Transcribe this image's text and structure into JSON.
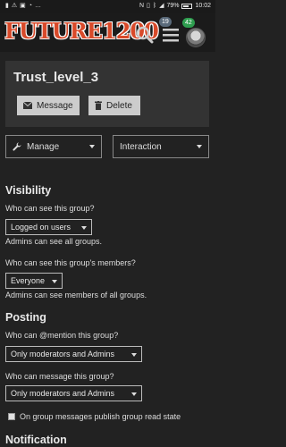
{
  "status_bar": {
    "icons_left": [
      "signal-icon",
      "warning-icon",
      "image-icon",
      "wifi-icon",
      "more-icon"
    ],
    "battery": "79%",
    "battery_level": 0.79,
    "time": "10:02"
  },
  "header": {
    "logo_text": "FUTURE1200",
    "notification_count": "19",
    "message_count": "42"
  },
  "group": {
    "title": "Trust_level_3",
    "message_button": "Message",
    "delete_button": "Delete"
  },
  "controls": {
    "manage": "Manage",
    "interaction": "Interaction"
  },
  "visibility": {
    "heading": "Visibility",
    "who_can_see_label": "Who can see this group?",
    "who_can_see_value": "Logged on users",
    "who_can_see_note": "Admins can see all groups.",
    "members_label": "Who can see this group's members?",
    "members_value": "Everyone",
    "members_note": "Admins can see members of all groups."
  },
  "posting": {
    "heading": "Posting",
    "mention_label": "Who can @mention this group?",
    "mention_value": "Only moderators and Admins",
    "message_label": "Who can message this group?",
    "message_value": "Only moderators and Admins",
    "checkbox_label": "On group messages publish group read state"
  },
  "notification": {
    "heading": "Notification"
  }
}
